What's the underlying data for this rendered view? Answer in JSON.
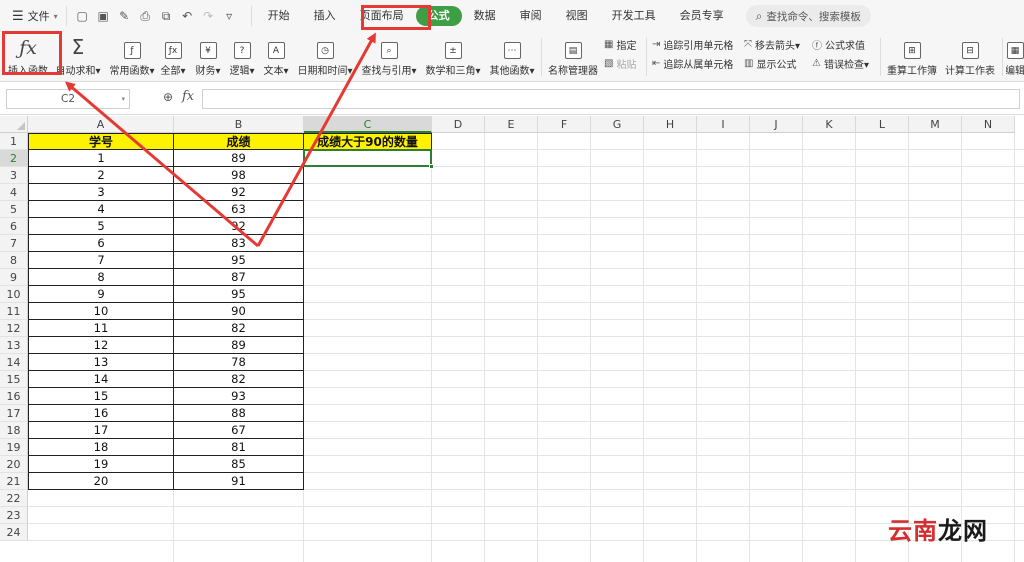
{
  "menubar": {
    "file_label": "文件",
    "tabs": [
      "开始",
      "插入",
      "页面布局",
      "公式",
      "数据",
      "审阅",
      "视图",
      "开发工具",
      "会员专享"
    ],
    "active_tab": "公式",
    "search_label": "查找命令、搜索模板"
  },
  "ribbon": {
    "insert_function": "插入函数",
    "autosum": "自动求和",
    "common_functions": "常用函数",
    "all": "全部",
    "finance": "财务",
    "logic": "逻辑",
    "text": "文本",
    "datetime": "日期和时间",
    "lookup": "查找与引用",
    "math": "数学和三角",
    "other_functions": "其他函数",
    "name_manager": "名称管理器",
    "define": "指定",
    "paste": "粘贴",
    "trace_precedents": "追踪引用单元格",
    "trace_dependents": "追踪从属单元格",
    "remove_arrows": "移去箭头",
    "show_formulas": "显示公式",
    "evaluate_formula": "公式求值",
    "error_check": "错误检查",
    "recalc_workbook": "重算工作簿",
    "calc_sheet": "计算工作表",
    "edit_links": "编辑"
  },
  "formula_bar": {
    "name_box": "C2",
    "formula": ""
  },
  "grid": {
    "columns": [
      "A",
      "B",
      "C",
      "D",
      "E",
      "F",
      "G",
      "H",
      "I",
      "J",
      "K",
      "L",
      "M",
      "N"
    ],
    "rows": [
      "1",
      "2",
      "3",
      "4",
      "5",
      "6",
      "7",
      "8",
      "9",
      "10",
      "11",
      "12",
      "13",
      "14",
      "15",
      "16",
      "17",
      "18",
      "19",
      "20",
      "21",
      "22",
      "23",
      "24"
    ],
    "selected_column": "C",
    "selected_row": "2"
  },
  "table": {
    "headers": [
      "学号",
      "成绩",
      "成绩大于90的数量"
    ],
    "ids": [
      "1",
      "2",
      "3",
      "4",
      "5",
      "6",
      "7",
      "8",
      "9",
      "10",
      "11",
      "12",
      "13",
      "14",
      "15",
      "16",
      "17",
      "18",
      "19",
      "20"
    ],
    "scores": [
      "89",
      "98",
      "92",
      "63",
      "92",
      "83",
      "95",
      "87",
      "95",
      "90",
      "82",
      "89",
      "78",
      "82",
      "93",
      "88",
      "67",
      "81",
      "85",
      "91"
    ]
  },
  "watermark": {
    "part1": "云南",
    "part2": "龙网"
  },
  "colors": {
    "accent": "#3d9e45",
    "highlight": "#e53935",
    "header_fill": "#fff200"
  }
}
